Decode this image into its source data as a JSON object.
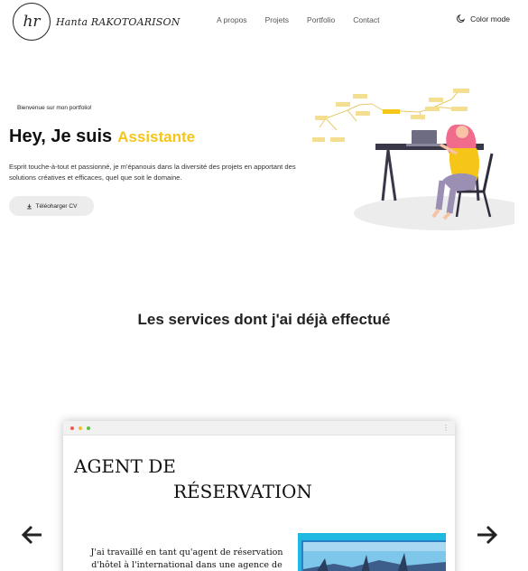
{
  "header": {
    "logo_initials": "hr",
    "logo_name": "Hanta RAKOTOARISON",
    "nav": [
      "A propos",
      "Projets",
      "Portfolio",
      "Contact"
    ],
    "color_mode_label": "Color mode"
  },
  "hero": {
    "welcome": "Bienvenue sur mon portfolio!",
    "title": "Hey, Je suis",
    "title_accent": "Assistante",
    "description": "Esprit touche-à-tout et passionné, je m'épanouis dans la diversité des projets en apportant des solutions créatives et efficaces, quel que soit le domaine.",
    "cv_button": "Téléoharger CV",
    "accent_color": "#f5c518"
  },
  "services": {
    "title": "Les services dont j'ai déjà effectué",
    "card": {
      "title_line1": "AGENT DE",
      "title_line2": "RÉSERVATION",
      "text": "J'ai travaillé en tant qu'agent de réservation d'hôtel à l'international dans une agence de voyage."
    }
  },
  "icons": {
    "color_mode": "moon-icon",
    "download": "download-icon",
    "prev": "arrow-left-icon",
    "next": "arrow-right-icon"
  }
}
